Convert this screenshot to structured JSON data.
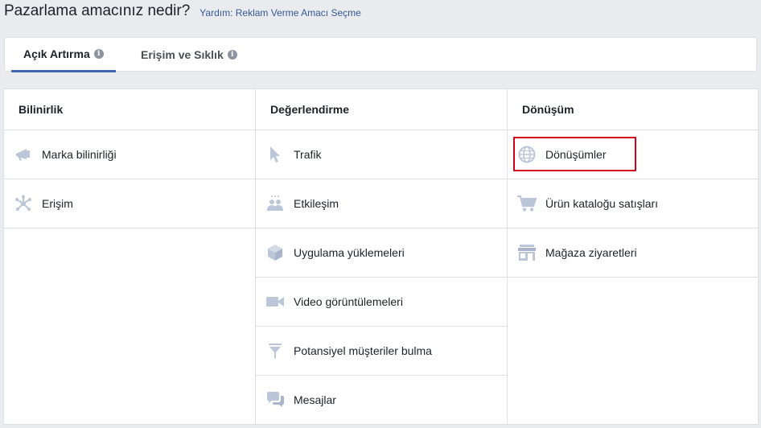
{
  "header": {
    "title": "Pazarlama amacınız nedir?",
    "help_link": "Yardım: Reklam Verme Amacı Seçme"
  },
  "tabs": [
    {
      "label": "Açık Artırma",
      "info": "i",
      "active": true
    },
    {
      "label": "Erişim ve Sıklık",
      "info": "i",
      "active": false
    }
  ],
  "columns": [
    {
      "heading": "Bilinirlik",
      "items": [
        {
          "label": "Marka bilinirliği",
          "icon": "megaphone-icon"
        },
        {
          "label": "Erişim",
          "icon": "reach-icon"
        }
      ]
    },
    {
      "heading": "Değerlendirme",
      "items": [
        {
          "label": "Trafik",
          "icon": "cursor-icon"
        },
        {
          "label": "Etkileşim",
          "icon": "people-icon"
        },
        {
          "label": "Uygulama yüklemeleri",
          "icon": "box-icon"
        },
        {
          "label": "Video görüntülemeleri",
          "icon": "video-camera-icon"
        },
        {
          "label": "Potansiyel müşteriler bulma",
          "icon": "funnel-icon"
        },
        {
          "label": "Mesajlar",
          "icon": "chat-bubbles-icon"
        }
      ]
    },
    {
      "heading": "Dönüşüm",
      "items": [
        {
          "label": "Dönüşümler",
          "icon": "globe-icon",
          "highlighted": true
        },
        {
          "label": "Ürün kataloğu satışları",
          "icon": "shopping-cart-icon"
        },
        {
          "label": "Mağaza ziyaretleri",
          "icon": "store-icon"
        }
      ]
    }
  ],
  "colors": {
    "accent": "#4267b2",
    "highlight_border": "#d0021b",
    "icon": "#bcc6d9",
    "link": "#365899"
  }
}
